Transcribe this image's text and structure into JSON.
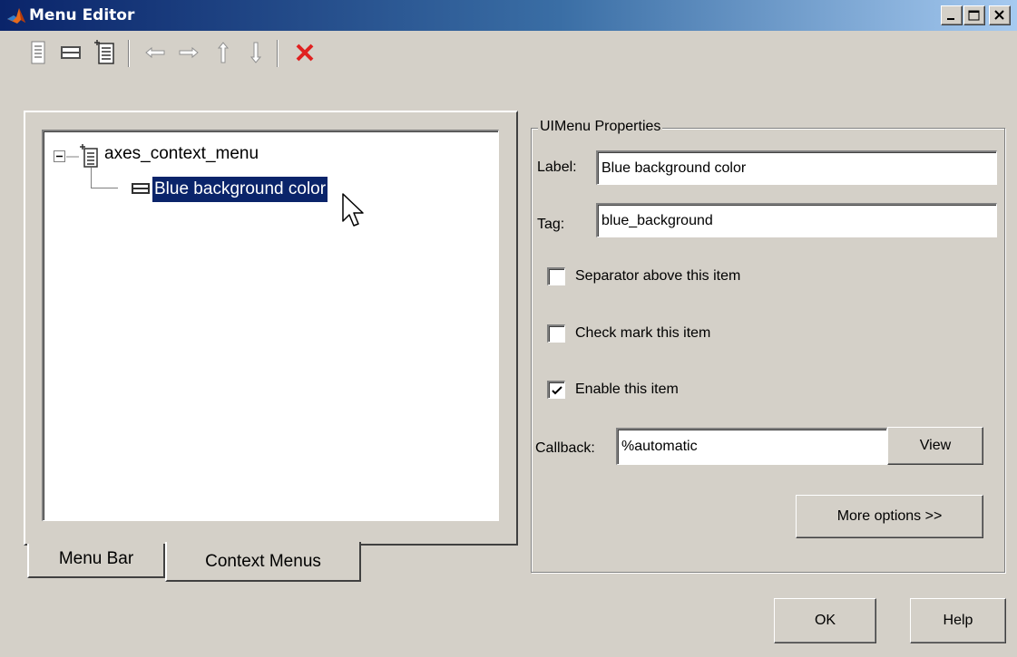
{
  "window": {
    "title": "Menu Editor"
  },
  "toolbar": {
    "items": [
      "new-menu-icon",
      "new-menu-item-icon",
      "new-context-menu-icon",
      "move-left-icon",
      "move-right-icon",
      "move-up-icon",
      "move-down-icon",
      "delete-icon"
    ]
  },
  "tree": {
    "root_label": "axes_context_menu",
    "child_label": "Blue background color"
  },
  "tabs": [
    "Menu Bar",
    "Context Menus"
  ],
  "active_tab": "Context Menus",
  "properties": {
    "group_title": "UIMenu Properties",
    "label_caption": "Label:",
    "label_value": "Blue background color",
    "tag_caption": "Tag:",
    "tag_value": "blue_background",
    "separator_label": "Separator above this item",
    "separator_checked": false,
    "checkmark_label": "Check mark this item",
    "checkmark_checked": false,
    "enable_label": "Enable this item",
    "enable_checked": true,
    "callback_caption": "Callback:",
    "callback_value": "%automatic",
    "view_button": "View",
    "more_options_button": "More options >>"
  },
  "footer": {
    "ok_button": "OK",
    "help_button": "Help"
  },
  "colors": {
    "selection": "#0a246a",
    "delete": "#e02020",
    "face": "#d4d0c8"
  }
}
